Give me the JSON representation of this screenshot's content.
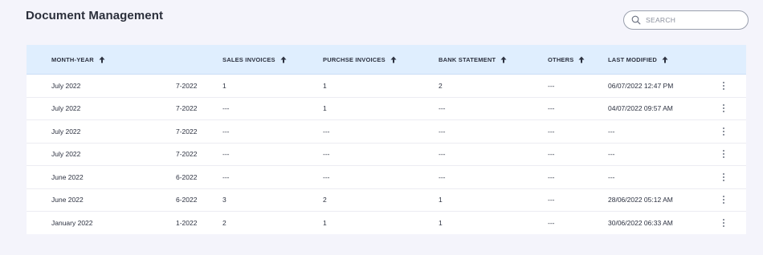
{
  "page": {
    "title": "Document Management"
  },
  "search": {
    "placeholder": "SEARCH",
    "value": ""
  },
  "table": {
    "headers": {
      "month_year": "MONTH-YEAR",
      "sales_invoices": "SALES INVOICES",
      "purchase_invoices": "PURCHSE INVOICES",
      "bank_statement": "BANK STATEMENT",
      "others": "OTHERS",
      "last_modified": "LAST MODIFIED"
    },
    "rows": [
      {
        "month": "July 2022",
        "code": "7-2022",
        "sales": "1",
        "purchase": "1",
        "bank": "2",
        "others": "---",
        "modified": "06/07/2022 12:47 PM"
      },
      {
        "month": "July 2022",
        "code": "7-2022",
        "sales": "---",
        "purchase": "1",
        "bank": "---",
        "others": "---",
        "modified": "04/07/2022 09:57 AM"
      },
      {
        "month": "July 2022",
        "code": "7-2022",
        "sales": "---",
        "purchase": "---",
        "bank": "---",
        "others": "---",
        "modified": "---"
      },
      {
        "month": "July 2022",
        "code": "7-2022",
        "sales": "---",
        "purchase": "---",
        "bank": "---",
        "others": "---",
        "modified": "---"
      },
      {
        "month": "June 2022",
        "code": "6-2022",
        "sales": "---",
        "purchase": "---",
        "bank": "---",
        "others": "---",
        "modified": "---"
      },
      {
        "month": "June 2022",
        "code": "6-2022",
        "sales": "3",
        "purchase": "2",
        "bank": "1",
        "others": "---",
        "modified": "28/06/2022 05:12 AM"
      },
      {
        "month": "January 2022",
        "code": "1-2022",
        "sales": "2",
        "purchase": "1",
        "bank": "1",
        "others": "---",
        "modified": "30/06/2022 06:33 AM"
      }
    ]
  },
  "colors": {
    "background": "#f4f4fb",
    "header_bg": "#dfeefe",
    "text": "#2c3140"
  },
  "icons": {
    "search": "search-icon",
    "sort": "arrow-up-icon",
    "row_menu": "more-vertical-icon"
  }
}
